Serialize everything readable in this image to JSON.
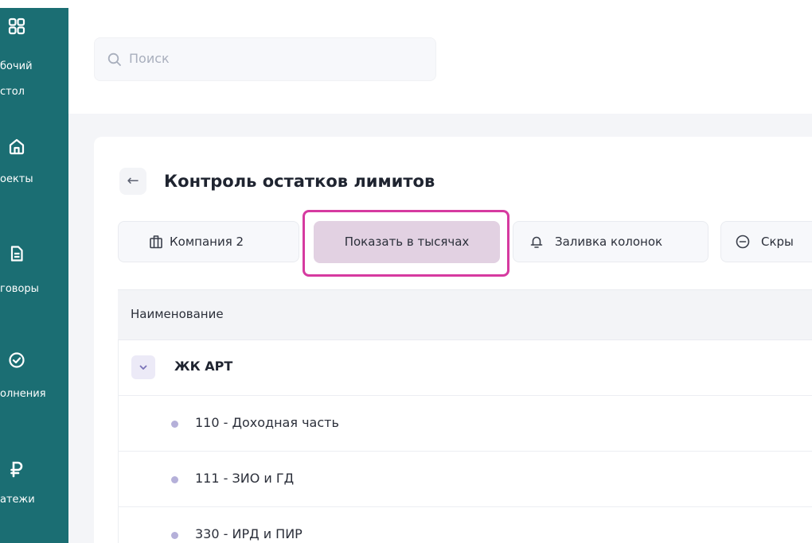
{
  "sidebar": {
    "items": [
      {
        "icon": "dashboard-grid-icon",
        "label_line1": "бочий",
        "label_line2": "стол"
      },
      {
        "icon": "home-icon",
        "label_line1": "оекты"
      },
      {
        "icon": "document-icon",
        "label_line1": "говоры"
      },
      {
        "icon": "check-circle-icon",
        "label_line1": "олнения"
      },
      {
        "icon": "ruble-icon",
        "label_line1": "атежи"
      }
    ],
    "bg_color": "#1b6e73"
  },
  "search": {
    "placeholder": "Поиск"
  },
  "page": {
    "title": "Контроль остатков лимитов"
  },
  "toolbar": {
    "company_label": "Компания 2",
    "thousands_label": "Показать в тысячах",
    "fill_label": "Заливка колонок",
    "hide_label": "Скры"
  },
  "table": {
    "header_name": "Наименование",
    "group": {
      "name": "ЖК АРТ"
    },
    "rows": [
      {
        "label": "110 - Доходная часть"
      },
      {
        "label": "111 - ЗИО и ГД"
      },
      {
        "label": "330 - ИРД и ПИР"
      }
    ]
  },
  "colors": {
    "highlight_frame": "#d63aa0",
    "active_button": "#e2d1e2",
    "bullet": "#b5b0d9"
  }
}
